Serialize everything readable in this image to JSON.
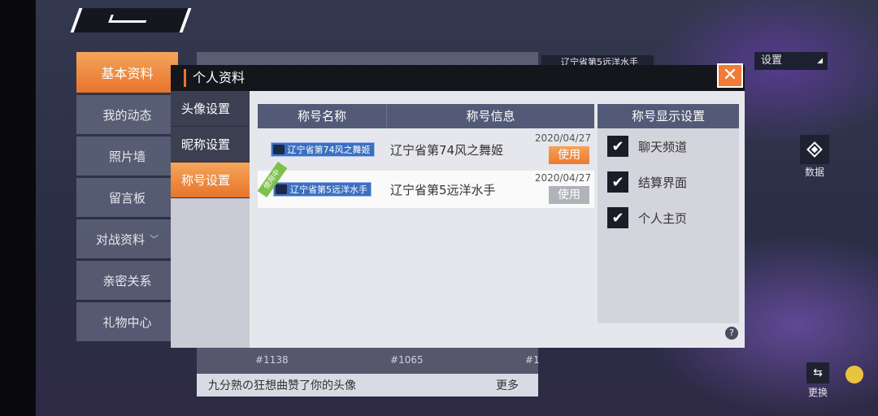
{
  "background": {
    "side_nav": [
      {
        "label": "基本资料",
        "active": true
      },
      {
        "label": "我的动态"
      },
      {
        "label": "照片墙"
      },
      {
        "label": "留言板"
      },
      {
        "label": "对战资料",
        "has_chevron": true
      },
      {
        "label": "亲密关系"
      },
      {
        "label": "礼物中心"
      }
    ],
    "settings_label": "设置",
    "title_badge": "辽宁省第5远洋水手",
    "data_button_label": "数据",
    "swap_button_label": "更换",
    "ids": [
      "#1138",
      "#1065",
      "#1"
    ],
    "bottom_message": "九分熟の狂想曲赞了你的头像",
    "more_label": "更多"
  },
  "modal": {
    "title": "个人资料",
    "close_glyph": "✕",
    "tabs": [
      {
        "label": "头像设置"
      },
      {
        "label": "昵称设置"
      },
      {
        "label": "称号设置",
        "active": true
      }
    ],
    "table": {
      "header_name": "称号名称",
      "header_info": "称号信息",
      "rows": [
        {
          "badge": "辽宁省第74风之舞姬",
          "info": "辽宁省第74风之舞姬",
          "date": "2020/04/27",
          "action": "使用",
          "in_use": false
        },
        {
          "badge": "辽宁省第5远洋水手",
          "info": "辽宁省第5远洋水手",
          "date": "2020/04/27",
          "action": "使用",
          "in_use": true,
          "ribbon": "使用中"
        }
      ]
    },
    "display_settings": {
      "header": "称号显示设置",
      "options": [
        {
          "label": "聊天频道",
          "checked": true
        },
        {
          "label": "结算界面",
          "checked": true
        },
        {
          "label": "个人主页",
          "checked": true
        }
      ]
    },
    "help_glyph": "?"
  },
  "colors": {
    "accent_orange": "#e8742c",
    "header_blue": "#535a77",
    "badge_blue": "#3b6fc0",
    "in_use_green": "#7cc14d"
  }
}
